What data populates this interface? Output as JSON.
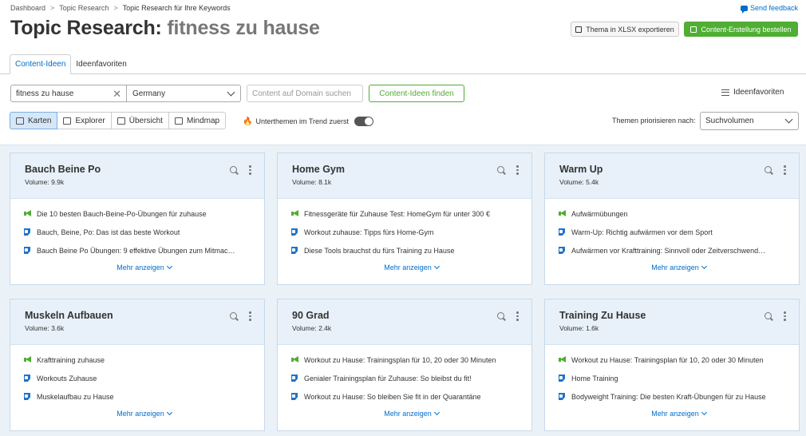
{
  "breadcrumb": [
    "Dashboard",
    "Topic Research",
    "Topic Research für Ihre Keywords"
  ],
  "feedback_label": "Send feedback",
  "title": {
    "prefix": "Topic Research:",
    "keyword": "fitness zu hause"
  },
  "buttons": {
    "export": "Thema in XLSX exportieren",
    "order": "Content-Erstellung bestellen"
  },
  "tabs": [
    {
      "label": "Content-Ideen",
      "active": true
    },
    {
      "label": "Ideenfavoriten",
      "active": false
    }
  ],
  "search": {
    "value": "fitness zu hause",
    "country": "Germany",
    "domain_placeholder": "Content auf Domain suchen",
    "find_label": "Content-Ideen finden"
  },
  "favorites_link": "Ideenfavoriten",
  "views": [
    {
      "label": "Karten",
      "icon": "cards-icon",
      "active": true
    },
    {
      "label": "Explorer",
      "icon": "table-icon",
      "active": false
    },
    {
      "label": "Übersicht",
      "icon": "overview-icon",
      "active": false
    },
    {
      "label": "Mindmap",
      "icon": "mindmap-icon",
      "active": false
    }
  ],
  "trend_label": "Unterthemen im Trend zuerst",
  "prioritize": {
    "label": "Themen priorisieren nach:",
    "value": "Suchvolumen"
  },
  "more_label": "Mehr anzeigen",
  "cards": [
    {
      "title": "Bauch Beine Po",
      "volume": "Volume: 9.9k",
      "items": [
        {
          "icon": "megaphone-icon",
          "text": "Die 10 besten Bauch-Beine-Po-Übungen für zuhause"
        },
        {
          "icon": "question-icon",
          "text": "Bauch, Beine, Po: Das ist das beste Workout"
        },
        {
          "icon": "question-icon",
          "text": "Bauch Beine Po Übungen: 9 effektive Übungen zum Mitmac…"
        }
      ]
    },
    {
      "title": "Home Gym",
      "volume": "Volume: 8.1k",
      "items": [
        {
          "icon": "megaphone-icon",
          "text": "Fitnessgeräte für Zuhause Test: HomeGym für unter 300 €"
        },
        {
          "icon": "question-icon",
          "text": "Workout zuhause: Tipps fürs Home-Gym"
        },
        {
          "icon": "question-icon",
          "text": "Diese Tools brauchst du fürs Training zu Hause"
        }
      ]
    },
    {
      "title": "Warm Up",
      "volume": "Volume: 5.4k",
      "items": [
        {
          "icon": "megaphone-icon",
          "text": "Aufwärmübungen"
        },
        {
          "icon": "question-icon",
          "text": "Warm-Up: Richtig aufwärmen vor dem Sport"
        },
        {
          "icon": "question-icon",
          "text": "Aufwärmen vor Krafttraining: Sinnvoll oder Zeitverschwend…"
        }
      ]
    },
    {
      "title": "Muskeln Aufbauen",
      "volume": "Volume: 3.6k",
      "items": [
        {
          "icon": "megaphone-icon",
          "text": "Krafttraining zuhause"
        },
        {
          "icon": "question-icon",
          "text": "Workouts Zuhause"
        },
        {
          "icon": "question-icon",
          "text": "Muskelaufbau zu Hause"
        }
      ]
    },
    {
      "title": "90 Grad",
      "volume": "Volume: 2.4k",
      "items": [
        {
          "icon": "megaphone-icon",
          "text": "Workout zu Hause: Trainingsplan für 10, 20 oder 30 Minuten"
        },
        {
          "icon": "question-icon",
          "text": "Genialer Trainingsplan für Zuhause: So bleibst du fit!"
        },
        {
          "icon": "question-icon",
          "text": "Workout zu Hause: So bleiben Sie fit in der Quarantäne"
        }
      ]
    },
    {
      "title": "Training Zu Hause",
      "volume": "Volume: 1.6k",
      "items": [
        {
          "icon": "megaphone-icon",
          "text": "Workout zu Hause: Trainingsplan für 10, 20 oder 30 Minuten"
        },
        {
          "icon": "question-icon",
          "text": "Home Training"
        },
        {
          "icon": "question-icon",
          "text": "Bodyweight Training: Die besten Kraft-Übungen für zu Hause"
        }
      ]
    }
  ],
  "colors": {
    "accent_blue": "#006dca",
    "brand_green": "#4fae33",
    "card_header": "#e8f1f9"
  }
}
